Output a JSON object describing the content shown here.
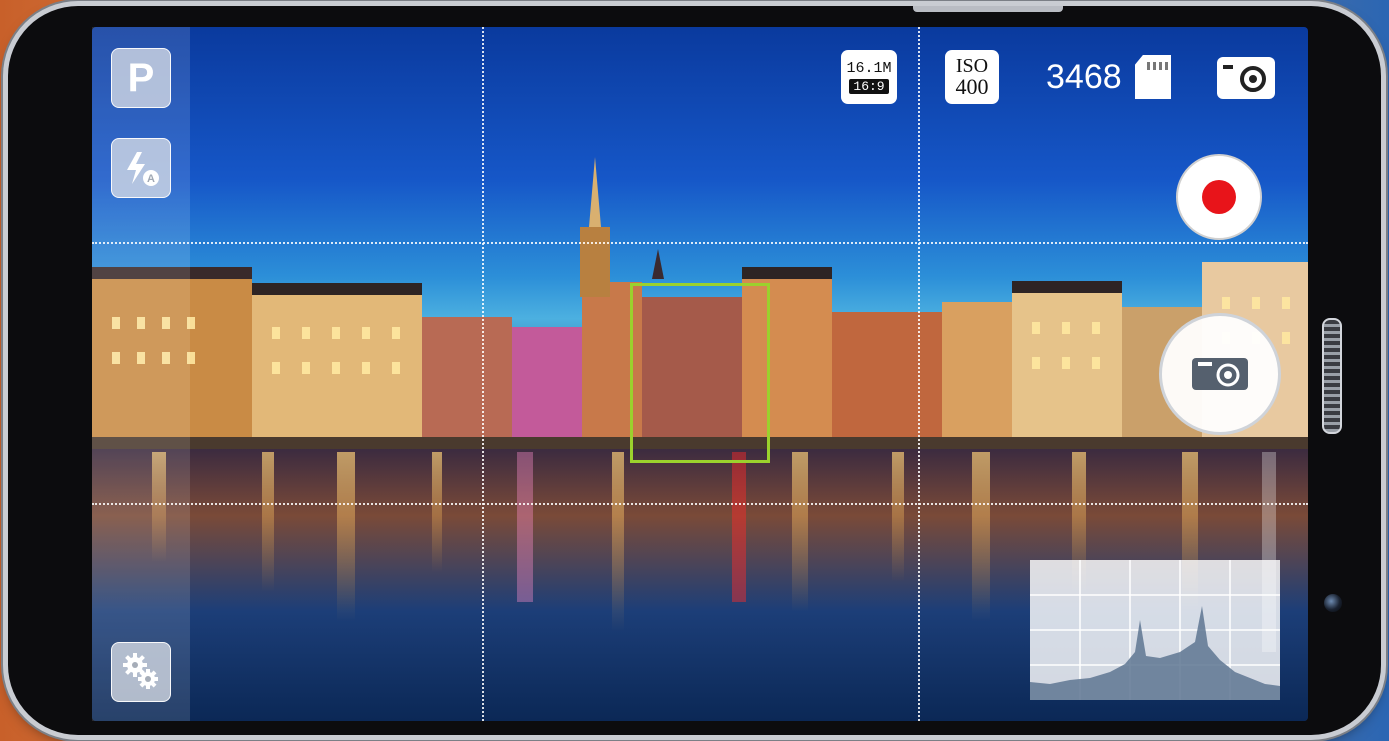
{
  "camera": {
    "mode_label": "P",
    "resolution_megapixels": "16.1M",
    "aspect_ratio": "16:9",
    "iso_label": "ISO",
    "iso_value": "400",
    "shots_remaining": "3468"
  },
  "icons": {
    "flash": "flash-auto-icon",
    "settings": "gears-icon",
    "storage": "sd-card-icon",
    "mode_switch": "camera-mode-icon",
    "record": "record-icon",
    "shutter": "camera-shutter-icon"
  },
  "colors": {
    "record_red": "#e8141a",
    "focus_green": "#9bd12d"
  }
}
